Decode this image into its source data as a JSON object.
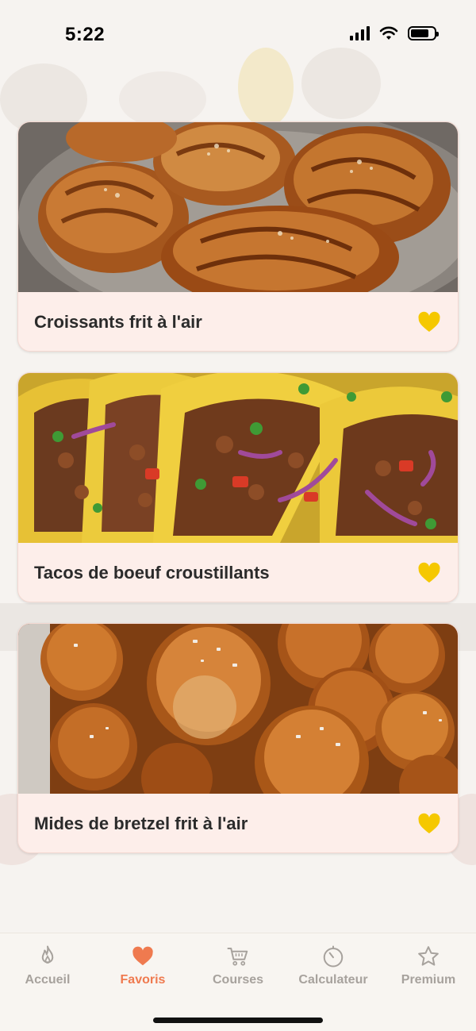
{
  "status_bar": {
    "time": "5:22",
    "battery_level": 0.8
  },
  "favorites": [
    {
      "title": "Croissants frit à l'air",
      "image": "croissants",
      "favorited": true
    },
    {
      "title": "Tacos de boeuf croustillants",
      "image": "tacos",
      "favorited": true
    },
    {
      "title": "Mides de bretzel frit à l'air",
      "image": "pretzel-bites",
      "favorited": true
    }
  ],
  "tab_bar": {
    "items": [
      {
        "label": "Accueil",
        "icon": "flame-icon",
        "active": false
      },
      {
        "label": "Favoris",
        "icon": "heart-icon",
        "active": true
      },
      {
        "label": "Courses",
        "icon": "cart-icon",
        "active": false
      },
      {
        "label": "Calculateur",
        "icon": "timer-icon",
        "active": false
      },
      {
        "label": "Premium",
        "icon": "star-icon",
        "active": false
      }
    ]
  },
  "colors": {
    "accent": "#ef7a4f",
    "heart_yellow": "#f5c800",
    "card_bg": "#fdeeea",
    "inactive": "#a7a29d"
  }
}
